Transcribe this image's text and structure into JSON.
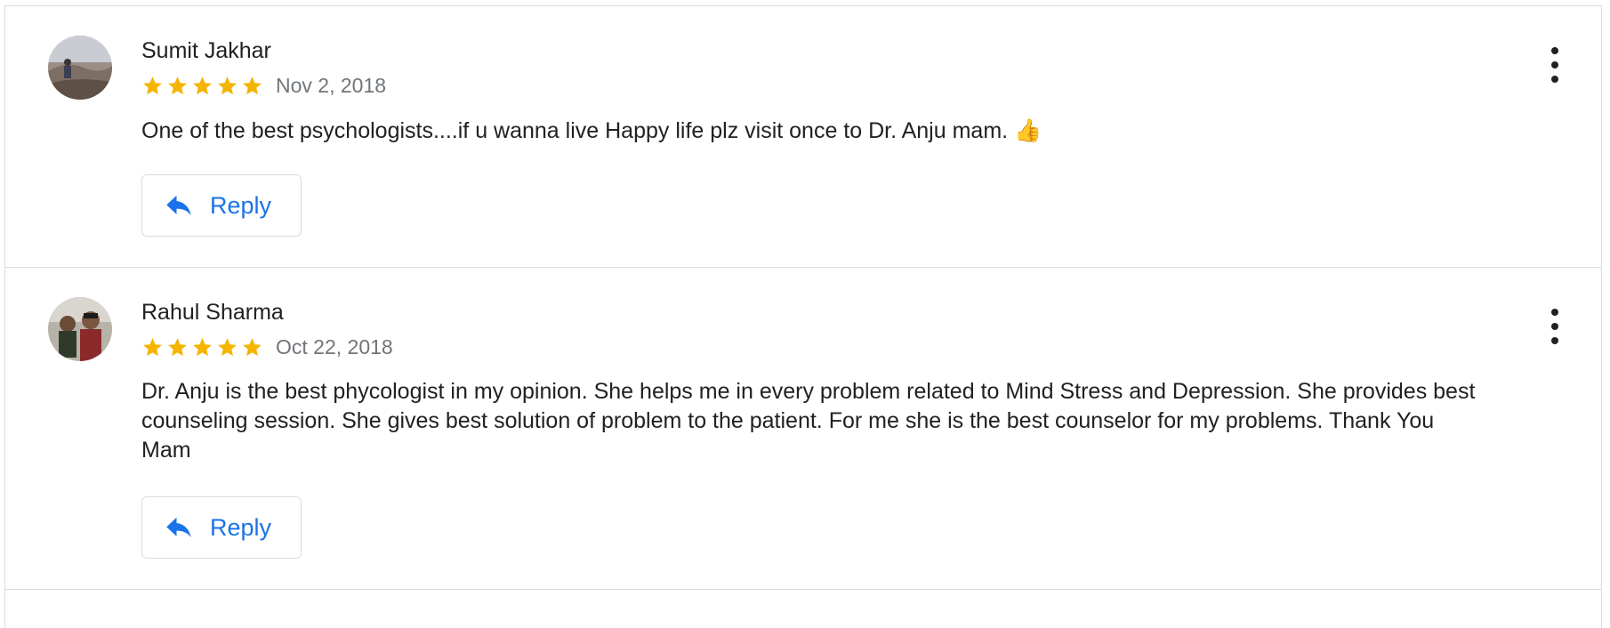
{
  "reviews": [
    {
      "reviewer": "Sumit Jakhar",
      "rating": 5,
      "date": "Nov 2, 2018",
      "text": "One of the best psychologists....if u wanna live Happy life plz visit once to Dr. Anju mam.",
      "emoji": "👍",
      "reply_label": "Reply"
    },
    {
      "reviewer": "Rahul Sharma",
      "rating": 5,
      "date": "Oct 22, 2018",
      "text": "Dr. Anju is the best phycologist in my opinion. She helps me in every problem related to Mind Stress and Depression. She provides best counseling session. She gives best solution of problem to the patient. For me she is the best counselor for my problems. Thank You Mam",
      "reply_label": "Reply"
    }
  ],
  "colors": {
    "star": "#f4b400",
    "accent": "#1a73e8",
    "divider": "#dadce0",
    "meta_text": "#70757a"
  },
  "icons": {
    "star": "star-icon",
    "reply": "reply-icon",
    "more": "more-vert-icon"
  }
}
